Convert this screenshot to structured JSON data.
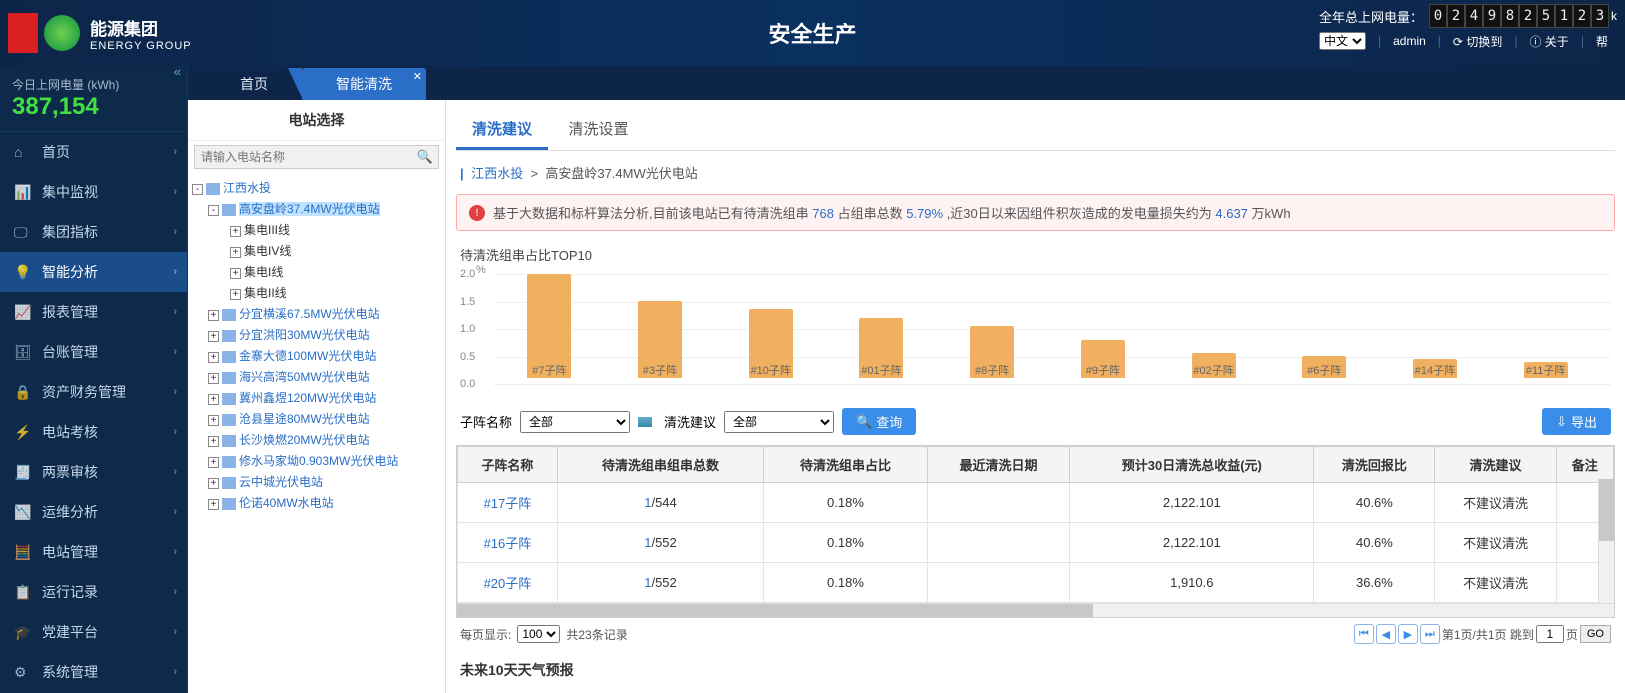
{
  "header": {
    "brand_cn": "能源集团",
    "brand_en": "ENERGY GROUP",
    "center_title": "安全生产",
    "year_label": "全年总上网电量：",
    "digits": [
      "0",
      "2",
      "4",
      "9",
      "8",
      "2",
      "5",
      "1",
      "2",
      "3"
    ],
    "unit_suffix": "k",
    "lang_options": [
      "中文"
    ],
    "lang_selected": "中文",
    "user": "admin",
    "switch": "切换到",
    "about": "关于",
    "help": "帮"
  },
  "today": {
    "label": "今日上网电量 (kWh)",
    "value": "387,154"
  },
  "menu": [
    {
      "icon": "⌂",
      "label": "首页"
    },
    {
      "icon": "📊",
      "label": "集中监视"
    },
    {
      "icon": "🖵",
      "label": "集团指标"
    },
    {
      "icon": "💡",
      "label": "智能分析",
      "active": true
    },
    {
      "icon": "📈",
      "label": "报表管理"
    },
    {
      "icon": "🗄",
      "label": "台账管理"
    },
    {
      "icon": "🔒",
      "label": "资产财务管理"
    },
    {
      "icon": "⚡",
      "label": "电站考核"
    },
    {
      "icon": "🧾",
      "label": "两票审核"
    },
    {
      "icon": "📉",
      "label": "运维分析"
    },
    {
      "icon": "🧮",
      "label": "电站管理"
    },
    {
      "icon": "📋",
      "label": "运行记录"
    },
    {
      "icon": "🎓",
      "label": "党建平台"
    },
    {
      "icon": "⚙",
      "label": "系统管理"
    }
  ],
  "tabs": {
    "home": "首页",
    "active": "智能清洗"
  },
  "tree": {
    "title": "电站选择",
    "placeholder": "请输入电站名称",
    "root": "江西水投",
    "selected": "高安盘岭37.4MW光伏电站",
    "children": [
      "集电III线",
      "集电IV线",
      "集电I线",
      "集电II线"
    ],
    "siblings": [
      "分宜横溪67.5MW光伏电站",
      "分宜洪阳30MW光伏电站",
      "金寨大德100MW光伏电站",
      "海兴高湾50MW光伏电站",
      "冀州鑫煜120MW光伏电站",
      "沧县星途80MW光伏电站",
      "长沙焕燃20MW光伏电站",
      "修水马家坳0.903MW光伏电站",
      "云中城光伏电站",
      "伦诺40MW水电站"
    ]
  },
  "sub_tabs": {
    "suggest": "清洗建议",
    "settings": "清洗设置"
  },
  "crumb": {
    "root": "江西水投",
    "leaf": "高安盘岭37.4MW光伏电站",
    "sep": ">"
  },
  "alert": {
    "p1": "基于大数据和标杆算法分析,目前该电站已有待清洗组串 ",
    "n1": "768",
    "p2": " 占组串总数 ",
    "n2": "5.79%",
    "p3": " ,近30日以来因组件积灰造成的发电量损失约为 ",
    "n3": "4.637",
    "p4": " 万kWh"
  },
  "chart_data": {
    "title": "待清洗组串占比TOP10",
    "type": "bar",
    "ylabel": "%",
    "ylim": [
      0,
      2.0
    ],
    "yticks": [
      0,
      0.5,
      1.0,
      1.5,
      2.0
    ],
    "categories": [
      "#7子阵",
      "#3子阵",
      "#10子阵",
      "#01子阵",
      "#8子阵",
      "#9子阵",
      "#02子阵",
      "#6子阵",
      "#14子阵",
      "#11子阵"
    ],
    "values": [
      1.9,
      1.4,
      1.25,
      1.1,
      0.95,
      0.7,
      0.45,
      0.4,
      0.35,
      0.3
    ]
  },
  "filters": {
    "array_label": "子阵名称",
    "array_value": "全部",
    "suggest_label": "清洗建议",
    "suggest_value": "全部",
    "query": "查询",
    "export": "导出"
  },
  "table": {
    "headers": [
      "子阵名称",
      "待清洗组串组串总数",
      "待清洗组串占比",
      "最近清洗日期",
      "预计30日清洗总收益(元)",
      "清洗回报比",
      "清洗建议",
      "备注"
    ],
    "rows": [
      {
        "name": "#17子阵",
        "c": "1",
        "t": "/544",
        "pct": "0.18%",
        "date": "",
        "gain": "2,122.101",
        "roi": "40.6%",
        "sug": "不建议清洗",
        "note": ""
      },
      {
        "name": "#16子阵",
        "c": "1",
        "t": "/552",
        "pct": "0.18%",
        "date": "",
        "gain": "2,122.101",
        "roi": "40.6%",
        "sug": "不建议清洗",
        "note": ""
      },
      {
        "name": "#20子阵",
        "c": "1",
        "t": "/552",
        "pct": "0.18%",
        "date": "",
        "gain": "1,910.6",
        "roi": "36.6%",
        "sug": "不建议清洗",
        "note": ""
      }
    ]
  },
  "pager": {
    "per_label": "每页显示:",
    "per_value": "100",
    "total": "共23条记录",
    "info": "第1页/共1页 跳到",
    "go_val": "1",
    "go_unit": "页",
    "go": "GO"
  },
  "forecast": "未来10天天气预报"
}
